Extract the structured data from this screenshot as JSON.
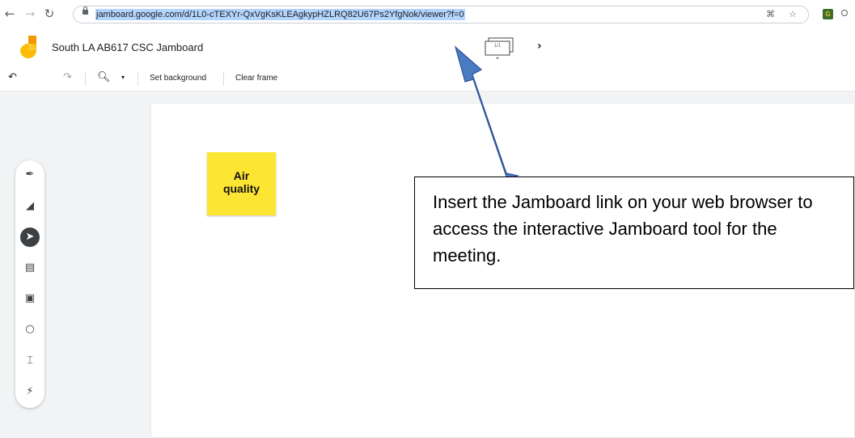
{
  "browser": {
    "url": "jamboard.google.com/d/1L0-cTEXYr-QxVgKsKLEAgkypHZLRQ82U67Ps2YfgNok/viewer?f=0"
  },
  "app": {
    "title": "South LA AB617 CSC Jamboard",
    "frame_indicator": "1/1"
  },
  "toolbar": {
    "set_background_label": "Set background",
    "clear_frame_label": "Clear frame"
  },
  "canvas": {
    "sticky_note": {
      "text": "Air quality",
      "color": "#fde633"
    }
  },
  "tools": [
    "pen-icon",
    "eraser-icon",
    "select-icon",
    "sticky-note-icon",
    "image-icon",
    "circle-icon",
    "text-box-icon",
    "laser-icon"
  ],
  "annotation": {
    "callout_text": "Insert the Jamboard link on your web browser to access the interactive Jamboard tool for the meeting.",
    "arrow_color": "#4a7abf"
  }
}
